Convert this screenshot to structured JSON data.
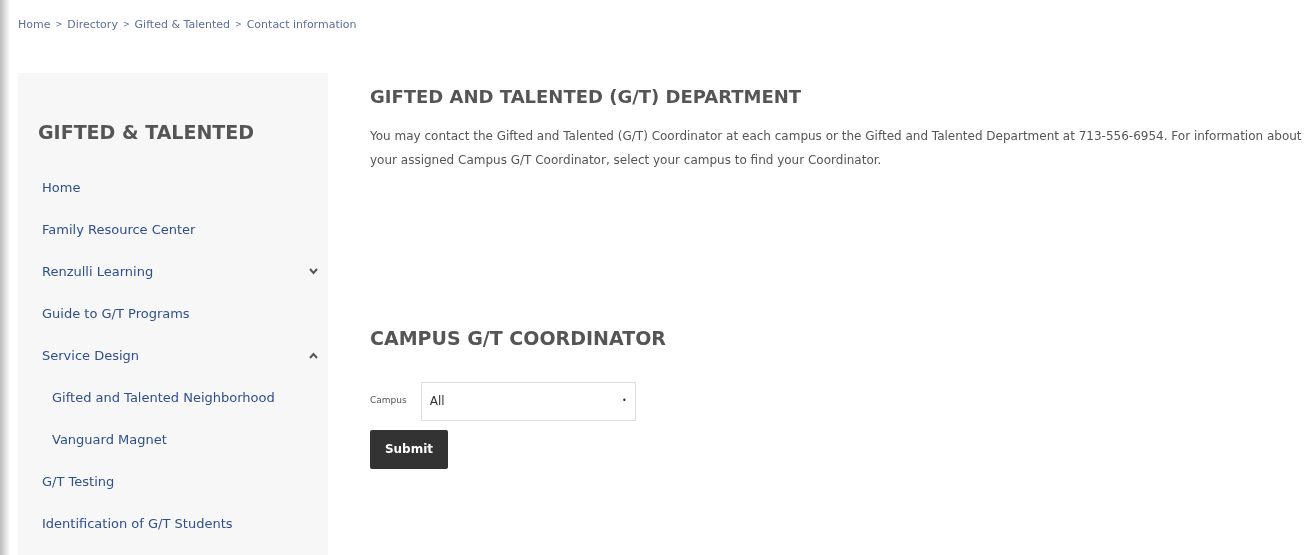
{
  "breadcrumb": {
    "separator": ">",
    "items": [
      "Home",
      "Directory",
      "Gifted & Talented",
      "Contact information"
    ]
  },
  "sidebar": {
    "title": "GIFTED & TALENTED",
    "items": [
      {
        "label": "Home"
      },
      {
        "label": "Family Resource Center"
      },
      {
        "label": "Renzulli Learning",
        "expanded": false
      },
      {
        "label": "Guide to G/T Programs"
      },
      {
        "label": "Service Design",
        "expanded": true,
        "children": [
          {
            "label": "Gifted and Talented Neighborhood"
          },
          {
            "label": "Vanguard Magnet"
          }
        ]
      },
      {
        "label": "G/T Testing"
      },
      {
        "label": "Identification of G/T Students"
      }
    ]
  },
  "department": {
    "heading": "GIFTED AND TALENTED (G/T) DEPARTMENT",
    "text": "You may contact the Gifted and Talented (G/T) Coordinator at each campus or the Gifted and Talented Department at 713-556-6954. For information about your assigned Campus G/T Coordinator, select your campus to find your Coordinator."
  },
  "coordinator": {
    "heading": "CAMPUS G/T COORDINATOR",
    "field_label": "Campus",
    "select_value": "All",
    "select_arrow": "•",
    "button": "Submit"
  }
}
